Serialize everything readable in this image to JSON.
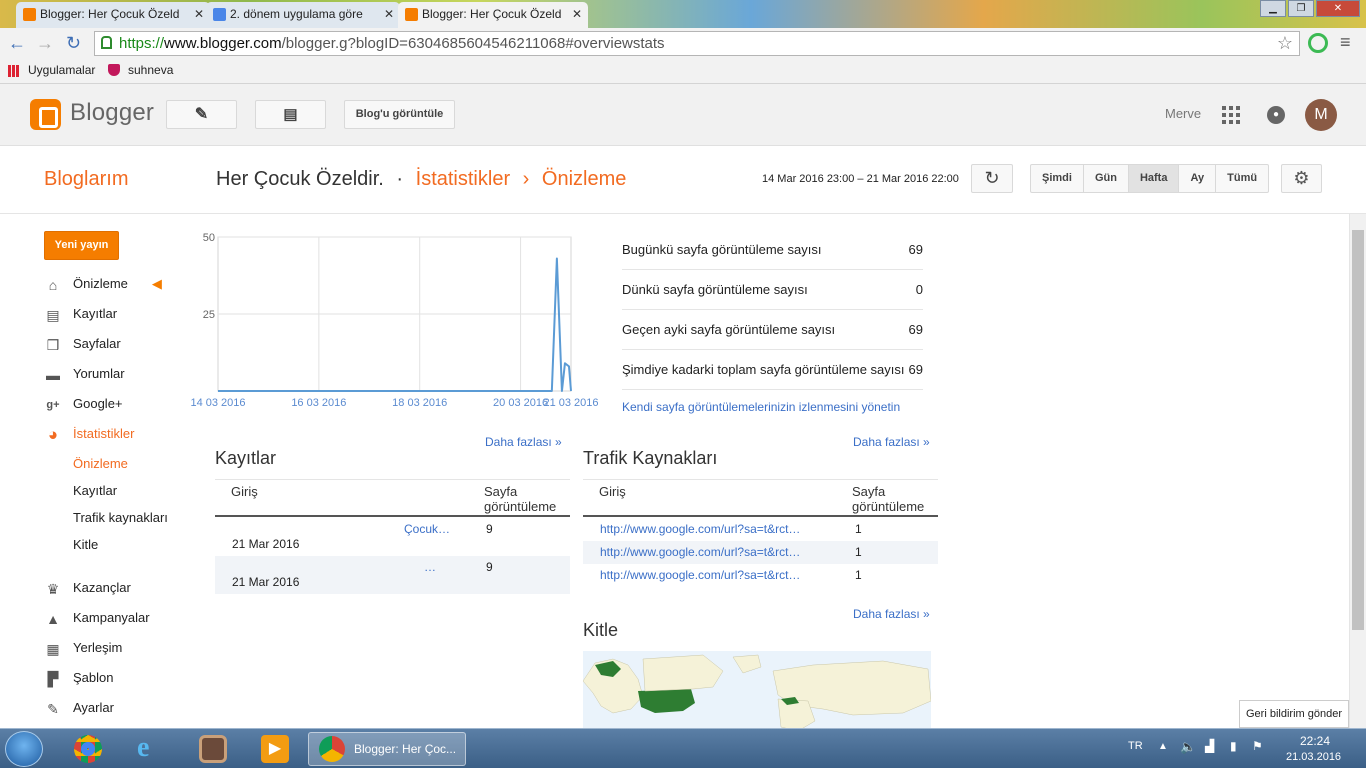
{
  "browser": {
    "tabs": [
      {
        "title": "Blogger: Her Çocuk Özeld",
        "close": "✕"
      },
      {
        "title": "2. dönem uygulama göre",
        "close": "✕"
      },
      {
        "title": "Blogger: Her Çocuk Özeld",
        "close": "✕"
      }
    ],
    "url_scheme": "https://",
    "url_host": "www.blogger.com",
    "url_path": "/blogger.g?blogID=6304685604546211068#overviewstats",
    "bookmarks": [
      "Uygulamalar",
      "suhneva"
    ]
  },
  "header": {
    "logo_text": "Blogger",
    "view_blog": "Blog'u görüntüle",
    "user_name": "Merve",
    "avatar_letter": "M"
  },
  "titlebar": {
    "bloglarim": "Bloglarım",
    "blog_name": "Her Çocuk Özeldir.",
    "sep": "·",
    "crumb1": "İstatistikler",
    "arrow": "›",
    "crumb2": "Önizleme",
    "date_range": "14 Mar 2016 23:00 – 21 Mar 2016 22:00",
    "ranges": [
      "Şimdi",
      "Gün",
      "Hafta",
      "Ay",
      "Tümü"
    ],
    "active_range": "Hafta"
  },
  "sidebar": {
    "new_post": "Yeni yayın",
    "items": [
      {
        "label": "Önizleme",
        "icon": "home-icon"
      },
      {
        "label": "Kayıtlar",
        "icon": "posts-icon"
      },
      {
        "label": "Sayfalar",
        "icon": "pages-icon"
      },
      {
        "label": "Yorumlar",
        "icon": "comment-icon"
      },
      {
        "label": "Google+",
        "icon": "google-plus-icon"
      },
      {
        "label": "İstatistikler",
        "icon": "stats-icon"
      }
    ],
    "sub_items": [
      "Önizleme",
      "Kayıtlar",
      "Trafik kaynakları",
      "Kitle"
    ],
    "items2": [
      {
        "label": "Kazançlar",
        "icon": "trophy-icon"
      },
      {
        "label": "Kampanyalar",
        "icon": "campaign-icon"
      },
      {
        "label": "Yerleşim",
        "icon": "layout-icon"
      },
      {
        "label": "Şablon",
        "icon": "paint-roller-icon"
      },
      {
        "label": "Ayarlar",
        "icon": "wrench-icon"
      }
    ]
  },
  "chart_data": {
    "type": "line",
    "x_labels": [
      "14 03 2016",
      "16 03 2016",
      "18 03 2016",
      "20 03 2016",
      "21 03 2016"
    ],
    "y_ticks": [
      50,
      25
    ],
    "ylim": [
      0,
      50
    ],
    "x_range": [
      0,
      7
    ],
    "series": [
      {
        "values": [
          [
            0,
            0
          ],
          [
            6.5,
            0
          ],
          [
            6.62,
            0
          ],
          [
            6.72,
            43
          ],
          [
            6.82,
            0
          ],
          [
            6.88,
            9
          ],
          [
            6.96,
            8
          ],
          [
            7.0,
            0
          ]
        ],
        "color": "#5b9bd5"
      }
    ]
  },
  "stats": [
    {
      "label": "Bugünkü sayfa görüntüleme sayısı",
      "value": "69"
    },
    {
      "label": "Dünkü sayfa görüntüleme sayısı",
      "value": "0"
    },
    {
      "label": "Geçen ayki sayfa görüntüleme sayısı",
      "value": "69"
    },
    {
      "label": "Şimdiye kadarki toplam sayfa görüntüleme sayısı",
      "value": "69"
    }
  ],
  "stats_link": "Kendi sayfa görüntülemelerinizin izlenmesini yönetin",
  "more": "Daha fazlası »",
  "posts": {
    "title": "Kayıtlar",
    "col1": "Giriş",
    "col2a": "Sayfa",
    "col2b": "görüntüleme",
    "rows": [
      {
        "link": "Çocuk…",
        "date": "21 Mar 2016",
        "views": "9"
      },
      {
        "link": "…",
        "date": "21 Mar 2016",
        "views": "9"
      }
    ]
  },
  "traffic": {
    "title": "Trafik Kaynakları",
    "col1": "Giriş",
    "col2a": "Sayfa",
    "col2b": "görüntüleme",
    "rows": [
      {
        "url": "http://www.google.com/url?sa=t&rct…",
        "views": "1"
      },
      {
        "url": "http://www.google.com/url?sa=t&rct…",
        "views": "1"
      },
      {
        "url": "http://www.google.com/url?sa=t&rct…",
        "views": "1"
      }
    ]
  },
  "audience": {
    "title": "Kitle"
  },
  "feedback": "Geri bildirim gönder",
  "taskbar": {
    "active_window": "Blogger: Her Çoc...",
    "lang": "TR",
    "time": "22:24",
    "date": "21.03.2016"
  },
  "colors": {
    "blogger_orange": "#f26b21",
    "link_blue": "#3b6fc7",
    "map_green": "#2e7d32"
  }
}
